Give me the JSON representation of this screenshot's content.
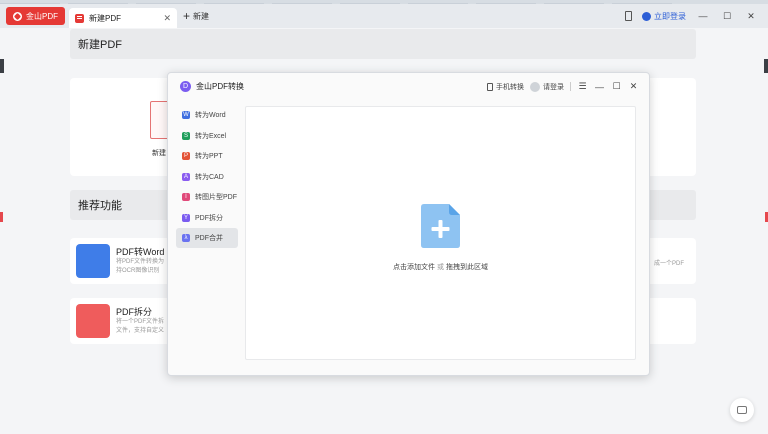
{
  "tabbar": {
    "app_label": "金山PDF",
    "active_tab_label": "新建PDF",
    "new_tab_label": "新建",
    "login_label": "立即登录"
  },
  "page": {
    "section_new_title": "新建PDF",
    "new_tile_label": "新建",
    "section_recommended_title": "推荐功能",
    "features": [
      {
        "title": "PDF转Word",
        "desc": "将PDF文件转换为 持OCR图像识别",
        "right_desc": "成一个PDF",
        "color": "#3f7de8"
      },
      {
        "title": "PDF拆分",
        "desc": "将一个PDF文件拆 文件，支持自定义",
        "right_desc": "",
        "color": "#ef5c5c"
      }
    ]
  },
  "dialog": {
    "title": "金山PDF转换",
    "logo_letter": "D",
    "mobile_label": "手机转换",
    "login_label": "请登录",
    "sidebar": [
      {
        "label": "转为Word",
        "icon": "W",
        "color": "#3f6fe0"
      },
      {
        "label": "转为Excel",
        "icon": "S",
        "color": "#1e9e5a"
      },
      {
        "label": "转为PPT",
        "icon": "P",
        "color": "#e35236"
      },
      {
        "label": "转为CAD",
        "icon": "A",
        "color": "#8a5cf0"
      },
      {
        "label": "转图片型PDF",
        "icon": "I",
        "color": "#e04a7a"
      },
      {
        "label": "PDF拆分",
        "icon": "Y",
        "color": "#7a5cf0"
      },
      {
        "label": "PDF合并",
        "icon": "λ",
        "color": "#6a72f0"
      }
    ],
    "drop": {
      "add_file": "点击添加文件",
      "or": "或",
      "drag": "拖拽到此区域"
    }
  }
}
